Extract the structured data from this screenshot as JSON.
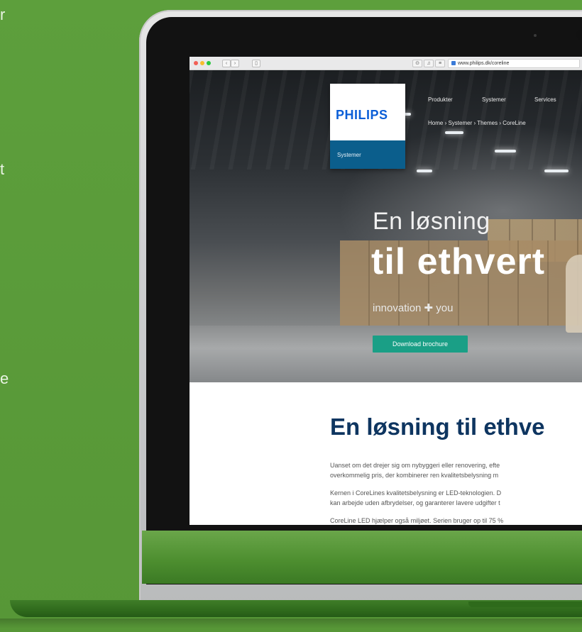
{
  "edge_fragments": [
    "r",
    "t",
    "e"
  ],
  "browser": {
    "url": "www.philips.dk/coreline",
    "back_icon": "chevron-left-icon",
    "forward_icon": "chevron-right-icon"
  },
  "site": {
    "logo": "PHILIPS",
    "logo_sub": "Systemer",
    "nav": [
      "Produkter",
      "Systemer",
      "Services"
    ],
    "breadcrumb": "Home ›  Systemer ›  Themes ›  CoreLine"
  },
  "hero": {
    "heading_small": "En løsning",
    "heading_big": "til ethvert",
    "tagline": "innovation ✚ you",
    "cta_label": "Download brochure"
  },
  "content": {
    "heading": "En løsning til ethve",
    "paragraphs": [
      "Uanset om det drejer sig om nybyggeri eller renovering, efte",
      "overkommelig pris, der kombinerer ren kvalitetsbelysning m",
      "Kernen i CoreLines kvalitetsbelysning er LED-teknologien. D",
      "kan arbejde uden afbrydelser, og garanterer lavere udgifter t",
      "CoreLine LED hjælper også miljøet. Serien bruger op til 75 %"
    ]
  },
  "colors": {
    "background_green": "#5a9b3a",
    "philips_blue": "#0b5ed7",
    "cta_teal": "#1a9f86",
    "heading_navy": "#0e3560"
  }
}
